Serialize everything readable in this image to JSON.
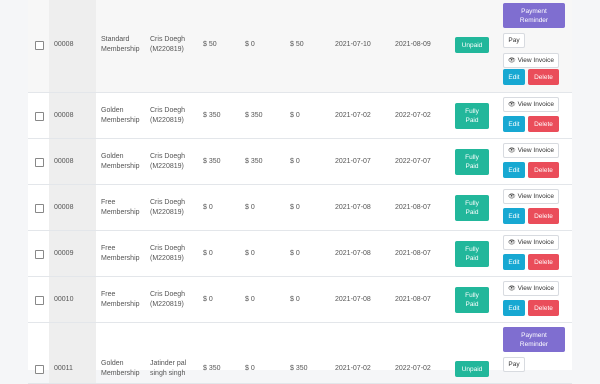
{
  "rows": [
    {
      "id": "00008",
      "plan": [
        "Standard",
        "Membership"
      ],
      "member": [
        "Cris Doegh",
        "(M220819)"
      ],
      "amount": "$ 50",
      "paid": "$ 0",
      "due": "$ 50",
      "start": "2021-07-10",
      "end": "2021-08-09",
      "status": [
        "Unpaid"
      ],
      "actions": "reminder"
    },
    {
      "id": "00008",
      "plan": [
        "Golden",
        "Membership"
      ],
      "member": [
        "Cris Doegh",
        "(M220819)"
      ],
      "amount": "$ 350",
      "paid": "$ 350",
      "due": "$ 0",
      "start": "2021-07-02",
      "end": "2022-07-02",
      "status": [
        "Fully",
        "Paid"
      ],
      "actions": "view"
    },
    {
      "id": "00008",
      "plan": [
        "Golden",
        "Membership"
      ],
      "member": [
        "Cris Doegh",
        "(M220819)"
      ],
      "amount": "$ 350",
      "paid": "$ 350",
      "due": "$ 0",
      "start": "2021-07-07",
      "end": "2022-07-07",
      "status": [
        "Fully",
        "Paid"
      ],
      "actions": "view"
    },
    {
      "id": "00008",
      "plan": [
        "Free",
        "Membership"
      ],
      "member": [
        "Cris Doegh",
        "(M220819)"
      ],
      "amount": "$ 0",
      "paid": "$ 0",
      "due": "$ 0",
      "start": "2021-07-08",
      "end": "2021-08-07",
      "status": [
        "Fully",
        "Paid"
      ],
      "actions": "view"
    },
    {
      "id": "00009",
      "plan": [
        "Free",
        "Membership"
      ],
      "member": [
        "Cris Doegh",
        "(M220819)"
      ],
      "amount": "$ 0",
      "paid": "$ 0",
      "due": "$ 0",
      "start": "2021-07-08",
      "end": "2021-08-07",
      "status": [
        "Fully",
        "Paid"
      ],
      "actions": "view"
    },
    {
      "id": "00010",
      "plan": [
        "Free",
        "Membership"
      ],
      "member": [
        "Cris Doegh",
        "(M220819)"
      ],
      "amount": "$ 0",
      "paid": "$ 0",
      "due": "$ 0",
      "start": "2021-07-08",
      "end": "2021-08-07",
      "status": [
        "Fully",
        "Paid"
      ],
      "actions": "view"
    },
    {
      "id": "00011",
      "plan": [
        "Golden",
        "Membership"
      ],
      "member": [
        "Jatinder pal",
        "singh singh"
      ],
      "amount": "$ 350",
      "paid": "$ 0",
      "due": "$ 350",
      "start": "2021-07-02",
      "end": "2022-07-02",
      "status": [
        "Unpaid"
      ],
      "actions": "reminder"
    }
  ],
  "labels": {
    "reminder": [
      "Payment",
      "Reminder"
    ],
    "pay": "Pay",
    "view": "View Invoice",
    "edit": "Edit",
    "delete": "Delete"
  },
  "colors": {
    "paid": "#22b79b",
    "reminder": "#7f6ed0",
    "edit": "#17a8d2",
    "delete": "#ea4d5a"
  },
  "icons": {
    "view": "eye-icon"
  }
}
